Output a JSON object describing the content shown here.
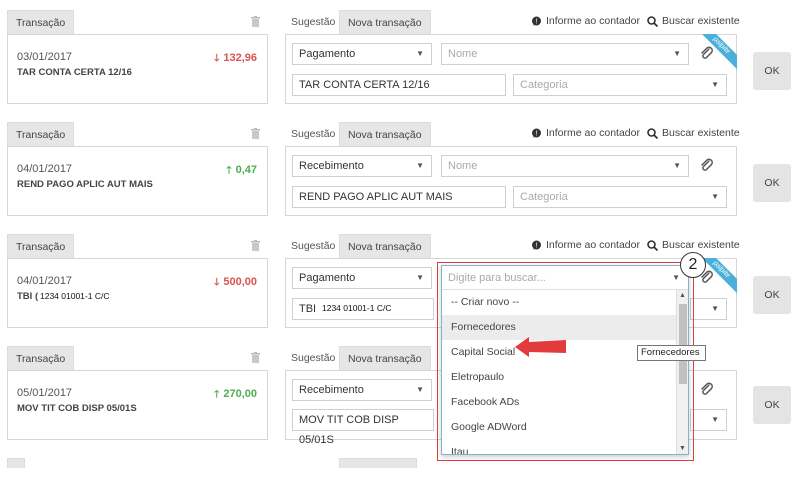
{
  "common": {
    "tab_transacao": "Transação",
    "tab_sugestao": "Sugestão",
    "tab_nova": "Nova transação",
    "informe": "Informe ao contador",
    "buscar": "Buscar existente",
    "ok": "OK",
    "nome_placeholder": "Nome",
    "categoria_placeholder": "Categoria",
    "palpite": "palpite"
  },
  "rows": [
    {
      "date": "03/01/2017",
      "desc": "TAR CONTA CERTA 12/16",
      "amount": "132,96",
      "direction": "down",
      "type": "Pagamento",
      "memo": "TAR CONTA CERTA 12/16"
    },
    {
      "date": "04/01/2017",
      "desc": "REND PAGO APLIC AUT MAIS",
      "amount": "0,47",
      "direction": "up",
      "type": "Recebimento",
      "memo": "REND PAGO APLIC AUT MAIS"
    },
    {
      "date": "04/01/2017",
      "desc": "TBI (",
      "amount": "500,00",
      "direction": "down",
      "type": "Pagamento",
      "memo": "TBI",
      "redacted": "1234 01001-1   C/C",
      "search_placeholder": "Digite para buscar..."
    },
    {
      "date": "05/01/2017",
      "desc": "MOV TIT COB DISP 05/01S",
      "amount": "270,00",
      "direction": "up",
      "type": "Recebimento",
      "memo": "MOV TIT COB DISP 05/01S"
    }
  ],
  "dropdown": {
    "items": [
      "-- Criar novo --",
      "Fornecedores",
      "Capital Social",
      "Eletropaulo",
      "Facebook ADs",
      "Google ADWord",
      "Itau"
    ],
    "highlighted_index": 1
  },
  "tooltip": "Fornecedores",
  "step_number": "2",
  "colors": {
    "negative": "#d9534f",
    "positive": "#4cae4c",
    "ribbon": "#4ab0d9",
    "annotation": "#e23b3b"
  }
}
